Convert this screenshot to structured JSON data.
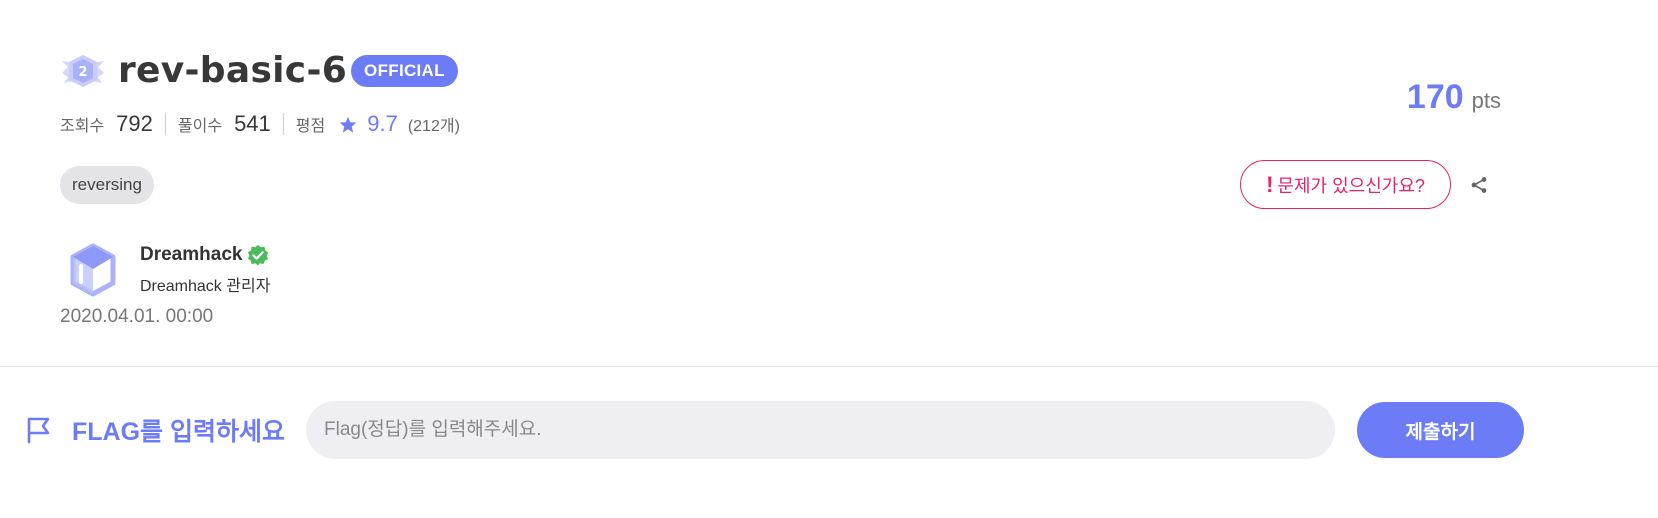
{
  "challenge": {
    "level_icon": "level-2-badge-icon",
    "level_number": "2",
    "title": "rev-basic-6",
    "official_badge": "OFFICIAL",
    "stats": {
      "views_label": "조회수",
      "views_value": "792",
      "solves_label": "풀이수",
      "solves_value": "541",
      "rating_label": "평점",
      "rating_icon": "star-icon",
      "rating_value": "9.7",
      "rating_count": "(212개)"
    },
    "tags": [
      "reversing"
    ],
    "author": {
      "avatar": "dreamhack-logo-icon",
      "name": "Dreamhack",
      "verified_icon": "verified-check-icon",
      "role": "Dreamhack 관리자"
    },
    "created_at": "2020.04.01. 00:00",
    "points_value": "170",
    "points_unit": "pts",
    "report_button": {
      "icon": "exclamation-icon",
      "icon_glyph": "!",
      "label": "문제가 있으신가요?"
    },
    "share_icon": "share-icon"
  },
  "flag_form": {
    "icon": "flag-icon",
    "label": "FLAG를 입력하세요",
    "input_placeholder": "Flag(정답)를 입력해주세요.",
    "input_value": "",
    "submit_label": "제출하기"
  },
  "colors": {
    "accent": "#6c7cf6",
    "danger": "#e5226e",
    "verified": "#4cbb5e",
    "tag_bg": "#e3e3e8",
    "input_bg": "#efeff3"
  }
}
